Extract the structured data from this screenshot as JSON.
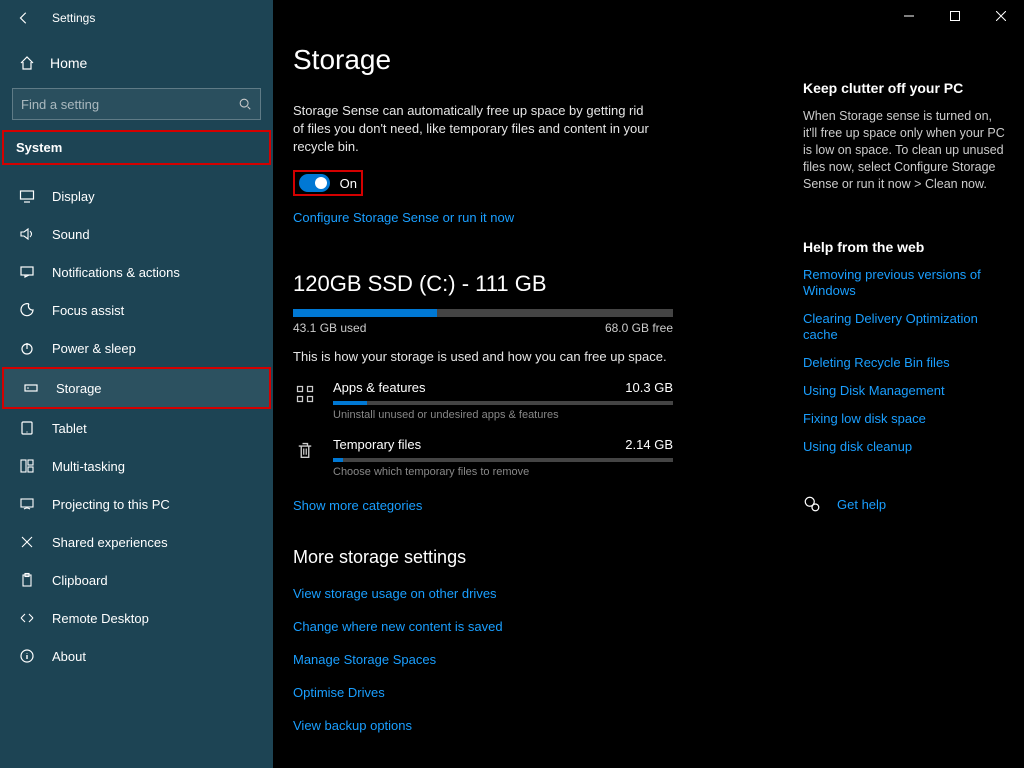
{
  "window": {
    "title": "Settings"
  },
  "sidebar": {
    "home": "Home",
    "search_placeholder": "Find a setting",
    "category": "System",
    "items": [
      {
        "label": "Display"
      },
      {
        "label": "Sound"
      },
      {
        "label": "Notifications & actions"
      },
      {
        "label": "Focus assist"
      },
      {
        "label": "Power & sleep"
      },
      {
        "label": "Storage"
      },
      {
        "label": "Tablet"
      },
      {
        "label": "Multi-tasking"
      },
      {
        "label": "Projecting to this PC"
      },
      {
        "label": "Shared experiences"
      },
      {
        "label": "Clipboard"
      },
      {
        "label": "Remote Desktop"
      },
      {
        "label": "About"
      }
    ]
  },
  "main": {
    "title": "Storage",
    "sense_desc": "Storage Sense can automatically free up space by getting rid of files you don't need, like temporary files and content in your recycle bin.",
    "toggle_label": "On",
    "configure": "Configure Storage Sense or run it now",
    "drive_title": "120GB SSD (C:) - 111 GB",
    "drive_used": "43.1 GB used",
    "drive_free": "68.0 GB free",
    "drive_desc": "This is how your storage is used and how you can free up space.",
    "categories": [
      {
        "name": "Apps & features",
        "size": "10.3 GB",
        "sub": "Uninstall unused or undesired apps & features",
        "pct": 10
      },
      {
        "name": "Temporary files",
        "size": "2.14 GB",
        "sub": "Choose which temporary files to remove",
        "pct": 3
      }
    ],
    "show_more": "Show more categories",
    "more_heading": "More storage settings",
    "more_links": [
      "View storage usage on other drives",
      "Change where new content is saved",
      "Manage Storage Spaces",
      "Optimise Drives",
      "View backup options"
    ]
  },
  "right": {
    "h1": "Keep clutter off your PC",
    "p1": "When Storage sense is turned on, it'll free up space only when your PC is low on space. To clean up unused files now, select Configure Storage Sense or run it now > Clean now.",
    "h2": "Help from the web",
    "links": [
      "Removing previous versions of Windows",
      "Clearing Delivery Optimization cache",
      "Deleting Recycle Bin files",
      "Using Disk Management",
      "Fixing low disk space",
      "Using disk cleanup"
    ],
    "gethelp": "Get help"
  }
}
